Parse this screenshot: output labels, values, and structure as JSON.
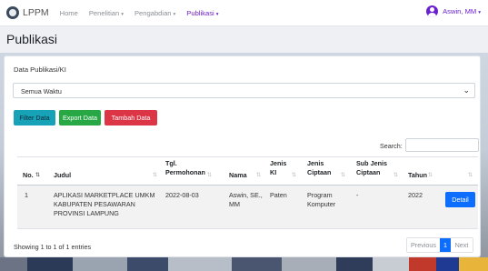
{
  "navbar": {
    "brand": "LPPM",
    "items": [
      {
        "label": "Home",
        "dropdown": false,
        "active": false
      },
      {
        "label": "Penelitian",
        "dropdown": true,
        "active": false
      },
      {
        "label": "Pengabdian",
        "dropdown": true,
        "active": false
      },
      {
        "label": "Publikasi",
        "dropdown": true,
        "active": true
      }
    ],
    "user": "Aswin, MM",
    "caret": "▾"
  },
  "page": {
    "title": "Publikasi"
  },
  "card": {
    "title": "Data Publikasi/KI",
    "filter_select": {
      "value": "Semua Waktu",
      "chevron": "⌄"
    },
    "buttons": {
      "filter": "Filter Data",
      "export": "Export Data",
      "tambah": "Tambah Data"
    },
    "search_label": "Search:",
    "search_value": ""
  },
  "table": {
    "columns": [
      "No.",
      "Judul",
      "Tgl. Permohonan",
      "Nama",
      "Jenis KI",
      "Jenis Ciptaan",
      "Sub Jenis Ciptaan",
      "Tahun",
      ""
    ],
    "sort_active": "⇅",
    "sort_icon": "⇅",
    "rows": [
      {
        "no": "1",
        "judul": "APLIKASI MARKETPLACE UMKM KABUPATEN PESAWARAN PROVINSI LAMPUNG",
        "tgl": "2022-08-03",
        "nama": "Aswin, SE., MM",
        "jenis_ki": "Paten",
        "jenis_ciptaan": "Program Komputer",
        "sub_jenis": "-",
        "tahun": "2022",
        "action": "Detail"
      }
    ]
  },
  "footer": {
    "info": "Showing 1 to 1 of 1 entries",
    "pager": {
      "prev": "Previous",
      "current": "1",
      "next": "Next"
    }
  },
  "icons": [
    "logo-icon",
    "user-avatar-icon",
    "chevron-down-icon",
    "sort-icon"
  ],
  "colors": {
    "active_nav": "#6f1fbf",
    "filter_btn": "#17a2b8",
    "export_btn": "#28a745",
    "tambah_btn": "#dc3545",
    "primary": "#0d6efd"
  }
}
